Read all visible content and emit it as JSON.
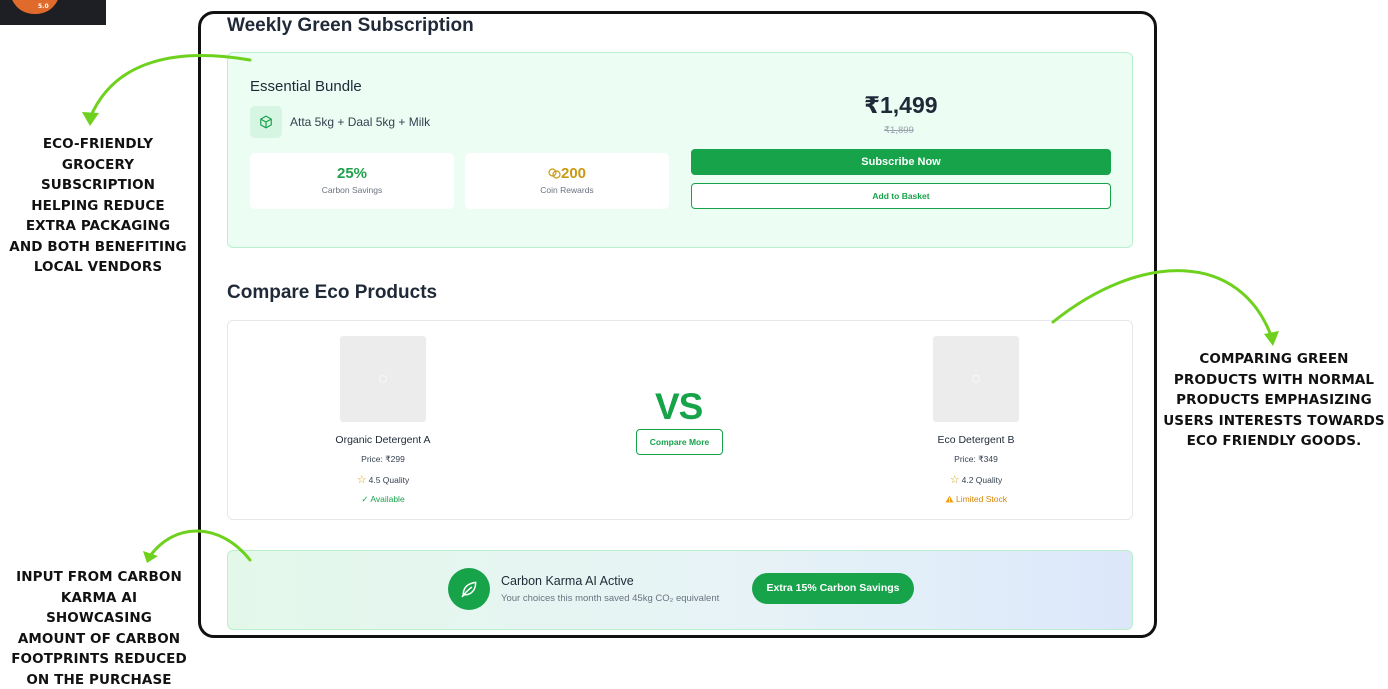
{
  "logo": {
    "badge_text": "5.0"
  },
  "annotations": {
    "subscription": "Eco-friendly grocery subscription helping reduce extra packaging and both benefiting local vendors",
    "compare": "Comparing green products with normal products emphasizing users interests towards eco friendly goods.",
    "carbon_karma": "Input from carbon karma AI showcasing amount of carbon footprints reduced on the purchase"
  },
  "subscription": {
    "title": "Weekly Green Subscription",
    "bundle_name": "Essential Bundle",
    "items": "Atta 5kg + Daal 5kg + Milk",
    "carbon_savings_value": "25%",
    "carbon_savings_label": "Carbon Savings",
    "coin_rewards_value": "200",
    "coin_rewards_label": "Coin Rewards",
    "price": "₹1,499",
    "original_price": "₹1,899",
    "subscribe_label": "Subscribe Now",
    "basket_label": "Add to Basket"
  },
  "compare": {
    "title": "Compare Eco Products",
    "vs_label": "VS",
    "compare_button": "Compare More",
    "products": [
      {
        "name": "Organic Detergent A",
        "price": "Price: ₹299",
        "quality": "4.5 Quality",
        "status": "✓ Available"
      },
      {
        "name": "Eco Detergent B",
        "price": "Price: ₹349",
        "quality": "4.2 Quality",
        "status": "Limited Stock"
      }
    ]
  },
  "carbon_karma": {
    "title": "Carbon Karma AI Active",
    "subtitle": "Your choices this month saved 45kg CO₂ equivalent",
    "pill_label": "Extra 15% Carbon Savings"
  },
  "colors": {
    "accent": "#16a34a",
    "coin": "#c99a12",
    "warning": "#d9850a"
  },
  "icons": [
    "package-icon",
    "coin-icon",
    "star-icon",
    "warning-icon",
    "leaf-icon",
    "arrow-icon"
  ]
}
